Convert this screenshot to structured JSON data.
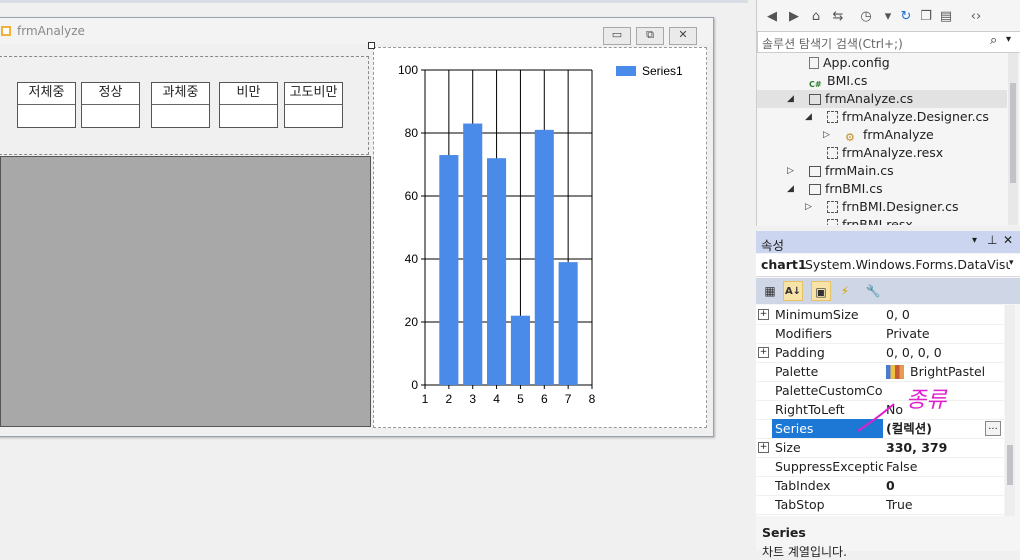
{
  "form": {
    "title": "frmAnalyze",
    "bmi_labels": [
      "저체중",
      "정상",
      "과체중",
      "비만",
      "고도비만"
    ],
    "window_buttons": [
      "▭",
      "⧉",
      "✕"
    ]
  },
  "chart_data": {
    "type": "bar",
    "x": [
      2,
      3,
      4,
      5,
      6,
      7
    ],
    "values": [
      73,
      83,
      72,
      22,
      81,
      39
    ],
    "series": [
      {
        "name": "Series1",
        "values": [
          73,
          83,
          72,
          22,
          81,
          39
        ]
      }
    ],
    "xlim": [
      1,
      8
    ],
    "ylim": [
      0,
      100
    ],
    "x_ticks": [
      "1",
      "2",
      "3",
      "4",
      "5",
      "6",
      "7",
      "8"
    ],
    "y_ticks": [
      "0",
      "20",
      "40",
      "60",
      "80",
      "100"
    ],
    "grid": true,
    "legend": "top-right",
    "bar_color": "#4a8ae8"
  },
  "solution_explorer": {
    "search_placeholder": "솔루션 탐색기 검색(Ctrl+;)",
    "items": [
      {
        "label": "App.config",
        "icon": "config-file-icon"
      },
      {
        "label": "BMI.cs",
        "icon": "csharp-file-icon"
      },
      {
        "label": "frmAnalyze.cs",
        "icon": "form-file-icon",
        "expanded": true
      },
      {
        "label": "frmAnalyze.Designer.cs",
        "icon": "designer-file-icon",
        "expanded": true
      },
      {
        "label": "frmAnalyze",
        "icon": "class-icon",
        "expanded": false
      },
      {
        "label": "frmAnalyze.resx",
        "icon": "resx-file-icon"
      },
      {
        "label": "frmMain.cs",
        "icon": "form-file-icon",
        "expanded": false
      },
      {
        "label": "frnBMI.cs",
        "icon": "form-file-icon",
        "expanded": true
      },
      {
        "label": "frnBMI.Designer.cs",
        "icon": "designer-file-icon",
        "expanded": false
      },
      {
        "label": "frnBMI.resx",
        "icon": "resx-file-icon"
      }
    ]
  },
  "properties": {
    "title": "속성",
    "object_name": "chart1",
    "object_type": "System.Windows.Forms.DataVisualiza",
    "rows": [
      {
        "name": "MinimumSize",
        "value": "0, 0",
        "expandable": true,
        "bold": false
      },
      {
        "name": "Modifiers",
        "value": "Private",
        "expandable": false,
        "bold": false
      },
      {
        "name": "Padding",
        "value": "0, 0, 0, 0",
        "expandable": true,
        "bold": false
      },
      {
        "name": "Palette",
        "value": "BrightPastel",
        "expandable": false,
        "bold": false
      },
      {
        "name": "PaletteCustomColors",
        "value": "",
        "expandable": false,
        "bold": false
      },
      {
        "name": "RightToLeft",
        "value": "No",
        "expandable": false,
        "bold": false
      },
      {
        "name": "Series",
        "value": "(컬렉션)",
        "expandable": false,
        "bold": true,
        "selected": true
      },
      {
        "name": "Size",
        "value": "330, 379",
        "expandable": true,
        "bold": true
      },
      {
        "name": "SuppressExceptions",
        "value": "False",
        "expandable": false,
        "bold": false
      },
      {
        "name": "TabIndex",
        "value": "0",
        "expandable": false,
        "bold": true
      },
      {
        "name": "TabStop",
        "value": "True",
        "expandable": false,
        "bold": false
      }
    ],
    "ellipsis_label": "...",
    "description_title": "Series",
    "description_text": "차트 계열입니다."
  },
  "annotation": {
    "text": "종류",
    "color": "#e020d0"
  }
}
